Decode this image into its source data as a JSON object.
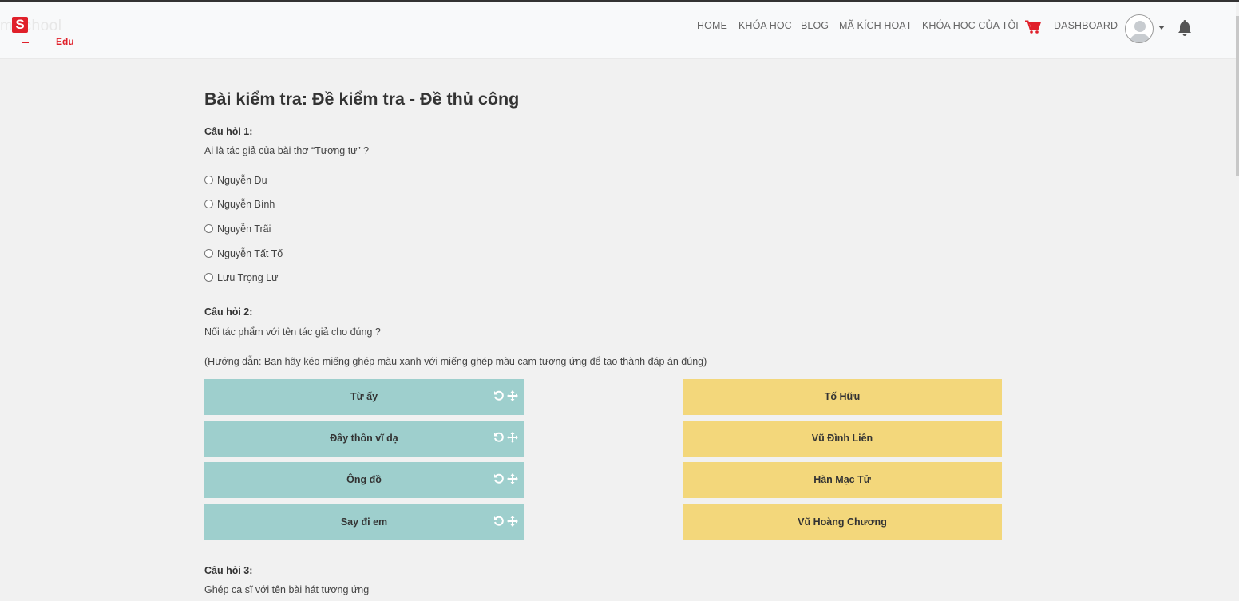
{
  "brand": {
    "logo_letter": "S",
    "logo_text": "mSchool",
    "logo_edu": "Edu"
  },
  "nav": {
    "items": [
      {
        "label": "HOME"
      },
      {
        "label": "KHÓA HỌC"
      },
      {
        "label": "BLOG"
      },
      {
        "label": "MÃ KÍCH HOẠT"
      },
      {
        "label": "KHÓA HỌC CỦA TÔI"
      },
      {
        "label": "DASHBOARD"
      }
    ],
    "cart_icon": "cart-icon",
    "bell_icon": "bell-icon",
    "cart_color": "#e0202a"
  },
  "page": {
    "title": "Bài kiểm tra: Đề kiểm tra - Đề thủ công"
  },
  "questions": [
    {
      "label": "Câu hỏi 1:",
      "text": "Ai là tác giả của bài thơ “Tương tư” ?",
      "options": [
        "Nguyễn Du",
        "Nguyễn Bính",
        "Nguyễn Trãi",
        "Nguyễn Tất Tố",
        "Lưu Trọng Lư"
      ]
    },
    {
      "label": "Câu hỏi 2:",
      "text": "Nối tác phẩm với tên tác giả cho đúng ?",
      "hint": "(Hướng dẫn: Bạn hãy kéo miếng ghép màu xanh với miếng ghép màu cam tương ứng để tạo thành đáp án đúng)",
      "left_tiles": [
        "Từ ấy",
        "Đây thôn vĩ dạ",
        "Ông đồ",
        "Say đi em"
      ],
      "right_tiles": [
        "Tố Hữu",
        "Vũ Đình Liên",
        "Hàn Mạc Tử",
        "Vũ Hoàng Chương"
      ],
      "tile_colors": {
        "blue": "#9ecfcd",
        "orange": "#f3d77b"
      }
    },
    {
      "label": "Câu hỏi 3:",
      "text": "Ghép ca sĩ với tên bài hát tương ứng"
    }
  ]
}
